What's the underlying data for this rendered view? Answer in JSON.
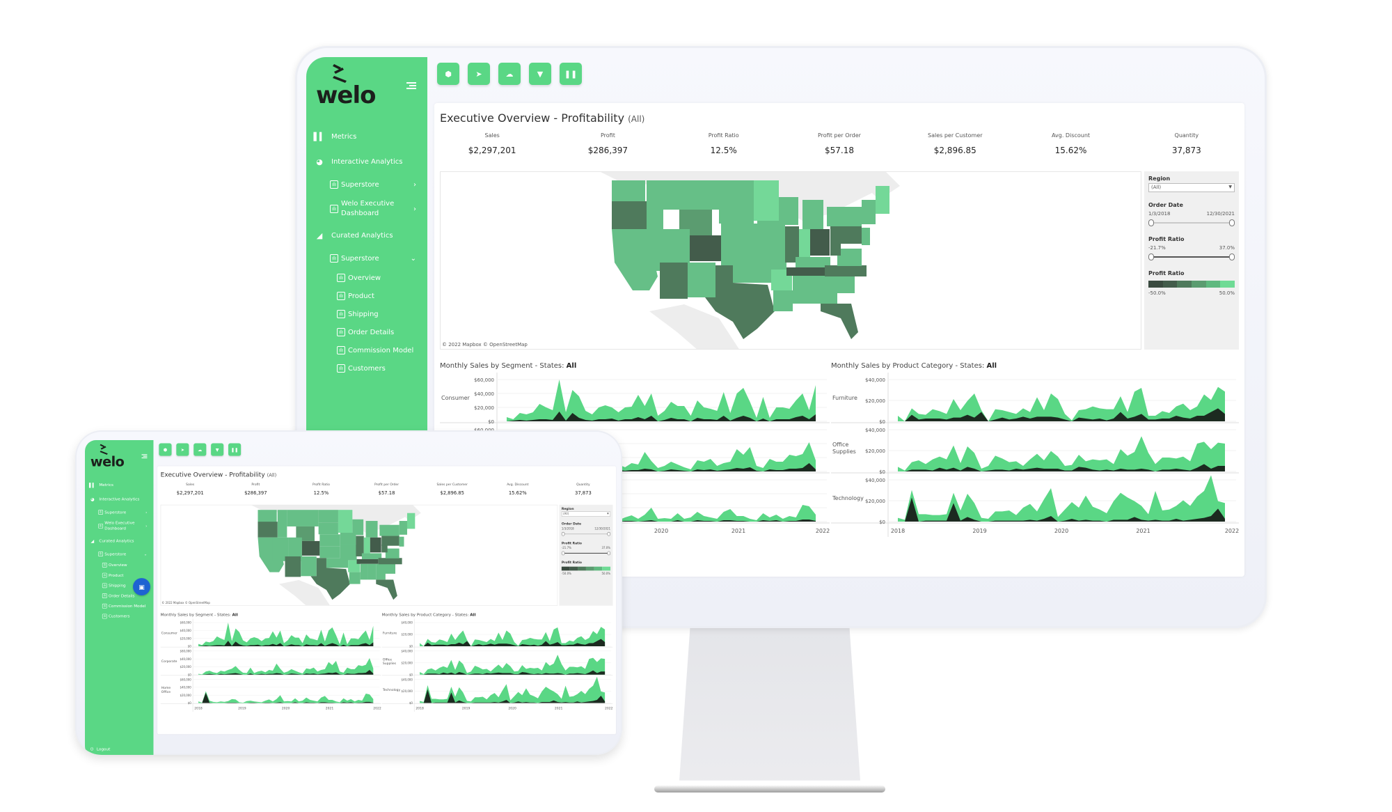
{
  "brand": {
    "name": "welo",
    "accent": "#5ad785",
    "dark": "#1c2a20"
  },
  "sidebar": {
    "items": [
      {
        "label": "Metrics",
        "icon": "bar-chart-icon"
      },
      {
        "label": "Interactive Analytics",
        "icon": "pie-chart-icon",
        "children": [
          {
            "label": "Superstore",
            "icon": "dashboard-icon",
            "chevron": "›"
          },
          {
            "label": "Welo Executive Dashboard",
            "icon": "dashboard-icon",
            "chevron": "›"
          }
        ]
      },
      {
        "label": "Curated Analytics",
        "icon": "area-chart-icon",
        "children": [
          {
            "label": "Superstore",
            "icon": "dashboard-icon",
            "chevron": "⌄",
            "children": [
              {
                "label": "Overview"
              },
              {
                "label": "Product"
              },
              {
                "label": "Shipping"
              },
              {
                "label": "Order Details"
              },
              {
                "label": "Commission Model"
              },
              {
                "label": "Customers"
              }
            ]
          }
        ]
      }
    ],
    "logout_label": "Logout"
  },
  "toolbar": {
    "buttons": [
      {
        "name": "box-icon",
        "glyph": "⬢"
      },
      {
        "name": "send-icon",
        "glyph": "➤"
      },
      {
        "name": "cloud-upload-icon",
        "glyph": "☁"
      },
      {
        "name": "filter-icon",
        "glyph": "▼"
      },
      {
        "name": "pause-icon",
        "glyph": "❚❚"
      }
    ]
  },
  "dashboard": {
    "title": "Executive Overview - Profitability",
    "title_suffix": "(All)",
    "kpis": [
      {
        "label": "Sales",
        "value": "$2,297,201"
      },
      {
        "label": "Profit",
        "value": "$286,397"
      },
      {
        "label": "Profit Ratio",
        "value": "12.5%"
      },
      {
        "label": "Profit per Order",
        "value": "$57.18"
      },
      {
        "label": "Sales per Customer",
        "value": "$2,896.85"
      },
      {
        "label": "Avg. Discount",
        "value": "15.62%"
      },
      {
        "label": "Quantity",
        "value": "37,873"
      }
    ],
    "map_credit": "© 2022 Mapbox  © OpenStreetMap",
    "filters": {
      "region_label": "Region",
      "region_value": "(All)",
      "order_date_label": "Order Date",
      "order_date_start": "1/3/2018",
      "order_date_end": "12/30/2021",
      "profit_ratio_label": "Profit Ratio",
      "profit_ratio_min": "-21.7%",
      "profit_ratio_max": "37.0%",
      "legend_label": "Profit Ratio",
      "legend_min": "-50.0%",
      "legend_max": "50.0%",
      "legend_colors": [
        "#3a4a3f",
        "#435c4b",
        "#4f7a5c",
        "#5b9c70",
        "#5fb97f",
        "#6fdb95"
      ]
    },
    "chat_icon": "chat-icon"
  },
  "chart_data": [
    {
      "type": "area",
      "title": "Monthly Sales by Segment - States:",
      "title_bold": "All",
      "x_ticks": [
        "2018",
        "2019",
        "2020",
        "2021",
        "2022"
      ],
      "yticks": [
        "$60,000",
        "$40,000",
        "$20,000",
        "$0"
      ],
      "ylim": [
        0,
        60000
      ],
      "panels": [
        {
          "name": "Consumer",
          "sales": [
            6,
            3,
            12,
            10,
            13,
            25,
            20,
            16,
            60,
            13,
            45,
            36,
            15,
            10,
            20,
            23,
            20,
            13,
            20,
            21,
            38,
            22,
            40,
            8,
            15,
            28,
            22,
            22,
            8,
            30,
            20,
            18,
            15,
            42,
            12,
            40,
            48,
            28,
            5,
            35,
            5,
            20,
            20,
            18,
            30,
            40,
            16,
            52
          ],
          "profit": [
            0,
            1,
            2,
            1,
            2,
            3,
            3,
            2,
            14,
            1,
            12,
            5,
            2,
            1,
            3,
            3,
            4,
            1,
            3,
            3,
            6,
            3,
            8,
            0,
            2,
            5,
            3,
            3,
            0,
            5,
            3,
            3,
            2,
            8,
            1,
            5,
            8,
            5,
            0,
            4,
            0,
            3,
            3,
            3,
            6,
            8,
            3,
            10
          ]
        },
        {
          "name": "Corporate",
          "sales": [
            2,
            1,
            8,
            10,
            6,
            4,
            10,
            8,
            12,
            15,
            22,
            12,
            5,
            4,
            18,
            4,
            8,
            10,
            6,
            12,
            10,
            28,
            15,
            5,
            8,
            14,
            10,
            6,
            3,
            16,
            14,
            18,
            8,
            12,
            14,
            32,
            24,
            35,
            8,
            5,
            18,
            14,
            14,
            24,
            22,
            25,
            42,
            16
          ],
          "profit": [
            0,
            0,
            1,
            2,
            1,
            0,
            2,
            1,
            2,
            3,
            4,
            2,
            0,
            0,
            3,
            0,
            1,
            2,
            1,
            2,
            2,
            4,
            3,
            0,
            1,
            3,
            2,
            1,
            0,
            3,
            2,
            3,
            1,
            2,
            3,
            5,
            4,
            6,
            1,
            0,
            3,
            2,
            2,
            4,
            4,
            5,
            12,
            3
          ]
        },
        {
          "name": "Home Office",
          "sales": [
            4,
            1,
            30,
            6,
            3,
            2,
            4,
            3,
            5,
            10,
            9,
            2,
            1,
            5,
            6,
            4,
            3,
            2,
            6,
            9,
            4,
            10,
            20,
            4,
            5,
            4,
            12,
            4,
            6,
            14,
            8,
            6,
            4,
            14,
            18,
            8,
            8,
            4,
            2,
            12,
            6,
            10,
            4,
            8,
            6,
            24,
            22,
            10
          ],
          "profit": [
            0,
            0,
            26,
            1,
            0,
            0,
            0,
            0,
            1,
            1,
            1,
            0,
            0,
            0,
            1,
            1,
            0,
            0,
            1,
            1,
            0,
            1,
            2,
            0,
            0,
            0,
            2,
            0,
            0,
            2,
            1,
            1,
            0,
            2,
            2,
            1,
            1,
            0,
            0,
            2,
            1,
            2,
            0,
            1,
            1,
            3,
            3,
            1
          ]
        }
      ]
    },
    {
      "type": "area",
      "title": "Monthly Sales by Product Category - States:",
      "title_bold": "All",
      "x_ticks": [
        "2018",
        "2019",
        "2020",
        "2021",
        "2022"
      ],
      "yticks": [
        "$40,000",
        "$20,000",
        "$0"
      ],
      "ylim": [
        0,
        45000
      ],
      "panels": [
        {
          "name": "Furniture",
          "sales": [
            6,
            0,
            14,
            8,
            7,
            13,
            11,
            8,
            24,
            12,
            22,
            30,
            12,
            0,
            13,
            12,
            10,
            8,
            14,
            10,
            26,
            12,
            30,
            24,
            8,
            1,
            12,
            13,
            16,
            14,
            13,
            13,
            27,
            10,
            32,
            36,
            6,
            6,
            11,
            9,
            16,
            19,
            12,
            16,
            29,
            23,
            37,
            32
          ],
          "profit": [
            0,
            0,
            7,
            2,
            3,
            3,
            3,
            2,
            4,
            4,
            7,
            4,
            10,
            0,
            2,
            4,
            2,
            3,
            5,
            3,
            5,
            5,
            5,
            4,
            2,
            0,
            4,
            3,
            2,
            3,
            1,
            3,
            10,
            3,
            5,
            8,
            2,
            2,
            3,
            3,
            6,
            4,
            3,
            6,
            6,
            10,
            14,
            8
          ]
        },
        {
          "name": "Office Supplies",
          "sales": [
            5,
            1,
            10,
            12,
            8,
            13,
            16,
            13,
            28,
            9,
            27,
            20,
            3,
            6,
            17,
            14,
            10,
            11,
            6,
            13,
            19,
            12,
            22,
            16,
            6,
            7,
            18,
            11,
            13,
            12,
            13,
            8,
            24,
            17,
            21,
            38,
            20,
            8,
            15,
            15,
            14,
            16,
            11,
            30,
            32,
            24,
            31,
            30
          ],
          "profit": [
            0,
            0,
            2,
            2,
            2,
            1,
            4,
            2,
            4,
            1,
            5,
            3,
            0,
            1,
            2,
            2,
            1,
            3,
            2,
            3,
            4,
            3,
            3,
            3,
            1,
            1,
            5,
            4,
            2,
            1,
            2,
            1,
            3,
            2,
            2,
            3,
            2,
            0,
            2,
            2,
            3,
            2,
            1,
            4,
            8,
            3,
            6,
            6
          ]
        },
        {
          "name": "Technology",
          "sales": [
            4,
            2,
            34,
            8,
            8,
            7,
            7,
            8,
            31,
            12,
            30,
            20,
            4,
            3,
            11,
            11,
            12,
            7,
            15,
            19,
            11,
            24,
            36,
            5,
            13,
            21,
            15,
            28,
            16,
            13,
            9,
            22,
            31,
            26,
            22,
            17,
            8,
            33,
            12,
            13,
            17,
            23,
            17,
            27,
            33,
            50,
            22,
            20
          ],
          "profit": [
            0,
            0,
            26,
            0,
            1,
            1,
            1,
            1,
            20,
            1,
            5,
            2,
            0,
            0,
            1,
            1,
            1,
            1,
            1,
            2,
            1,
            3,
            6,
            0,
            1,
            3,
            1,
            2,
            1,
            1,
            0,
            2,
            2,
            2,
            5,
            2,
            1,
            2,
            1,
            1,
            3,
            1,
            2,
            3,
            4,
            6,
            14,
            3
          ]
        }
      ]
    }
  ]
}
